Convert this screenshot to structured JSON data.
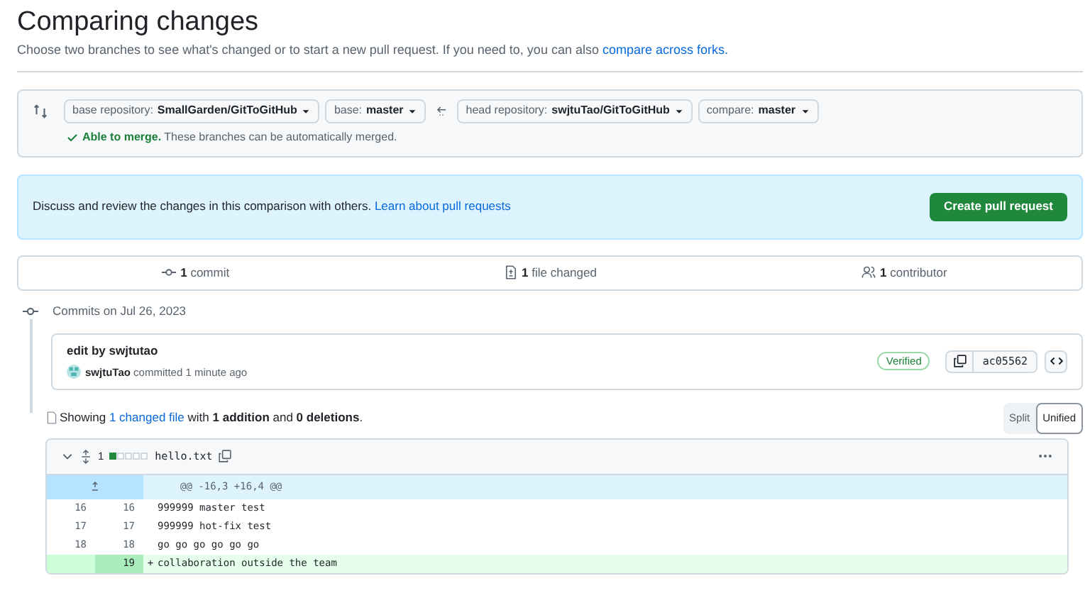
{
  "header": {
    "title": "Comparing changes",
    "subtitle": "Choose two branches to see what's changed or to start a new pull request. If you need to, you can also ",
    "subtitle_link": "compare across forks."
  },
  "range": {
    "selectors": [
      {
        "label": "base repository: ",
        "value": "SmallGarden/GitToGitHub"
      },
      {
        "label": "base: ",
        "value": "master"
      },
      {
        "label": "head repository: ",
        "value": "swjtuTao/GitToGitHub"
      },
      {
        "label": "compare: ",
        "value": "master"
      }
    ],
    "merge_status": "Able to merge.",
    "merge_note": "These branches can be automatically merged."
  },
  "banner": {
    "text": "Discuss and review the changes in this comparison with others. ",
    "link": "Learn about pull requests",
    "button": "Create pull request"
  },
  "stats": [
    {
      "kind": "commit",
      "count": "1",
      "label": "commit"
    },
    {
      "kind": "file",
      "count": "1",
      "label": "file changed"
    },
    {
      "kind": "contributor",
      "count": "1",
      "label": "contributor"
    }
  ],
  "commits_heading": "Commits on Jul 26, 2023",
  "commit": {
    "title": "edit by swjtutao",
    "author": "swjtuTao",
    "meta": "committed 1 minute ago",
    "badge": "Verified",
    "sha": "ac05562"
  },
  "summary_parts": {
    "before": "Showing ",
    "link": "1 changed file",
    "after": " with **1 addition** and **0 deletions**."
  },
  "view_toggle": [
    {
      "label": "Split",
      "selected": false
    },
    {
      "label": "Unified",
      "selected": true
    }
  ],
  "file": {
    "count": "1",
    "name": "hello.txt",
    "lines": [
      {
        "kind": "hunk",
        "text": "@@ -16,3 +16,4 @@"
      },
      {
        "kind": "context",
        "old": "16",
        "new": "16",
        "text": "999999 master test"
      },
      {
        "kind": "context",
        "old": "17",
        "new": "17",
        "text": "999999 hot-fix test"
      },
      {
        "kind": "context",
        "old": "18",
        "new": "18",
        "text": "go go go go go go"
      },
      {
        "kind": "addition",
        "new": "19",
        "sign": "+",
        "text": "collaboration outside the team"
      }
    ]
  }
}
